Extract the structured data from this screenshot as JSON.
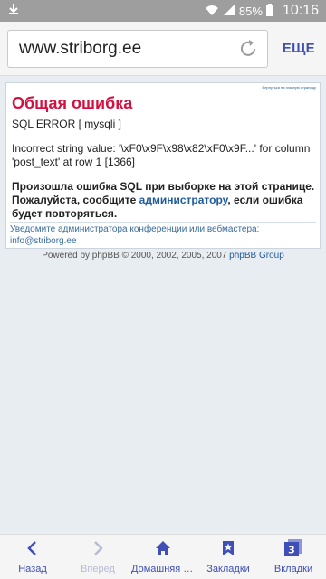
{
  "status_bar": {
    "battery": "85%",
    "time": "10:16"
  },
  "address_bar": {
    "url": "www.striborg.ee",
    "more_label": "ЕЩЕ"
  },
  "page": {
    "tiny_link": "Вернуться на главную страницу",
    "error_title": "Общая ошибка",
    "sql_error": "SQL ERROR [ mysqli ]",
    "incorrect_value": "Incorrect string value: '\\xF0\\x9F\\x98\\x82\\xF0\\x9F...' for column 'post_text' at row 1 [1366]",
    "message_part1": "Произошла ошибка SQL при выборке на этой странице. Пожалуйста, сообщите ",
    "message_link": "администратору",
    "message_part2": ", если ошибка будет повторяться.",
    "notify_line1": "Уведомите администратора конференции или вебмастера:",
    "notify_email": "info@striborg.ee",
    "powered_prefix": "Powered by phpBB © 2000, 2002, 2005, 2007 ",
    "powered_link": "phpBB Group"
  },
  "bottom_nav": {
    "back": "Назад",
    "forward": "Вперед",
    "home": "Домашняя страница",
    "bookmarks": "Закладки",
    "tabs": "Вкладки",
    "tab_count": "3"
  }
}
